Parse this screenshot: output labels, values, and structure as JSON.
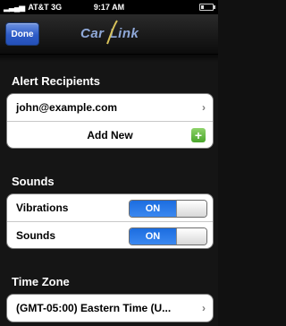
{
  "status_bar": {
    "carrier": "AT&T",
    "network": "3G",
    "time": "9:17 AM"
  },
  "nav": {
    "done_label": "Done",
    "logo_text_left": "Car",
    "logo_text_right": "Link"
  },
  "alert_recipients": {
    "title": "Alert Recipients",
    "email": "john@example.com",
    "add_new_label": "Add New"
  },
  "sounds": {
    "title": "Sounds",
    "rows": [
      {
        "label": "Vibrations",
        "state": "ON"
      },
      {
        "label": "Sounds",
        "state": "ON"
      }
    ]
  },
  "time_zone": {
    "title": "Time Zone",
    "value": "(GMT-05:00) Eastern Time (U..."
  },
  "colors": {
    "toggle_on": "#2f7be8",
    "done_button": "#3a66cc",
    "add_icon": "#5cb83a"
  }
}
